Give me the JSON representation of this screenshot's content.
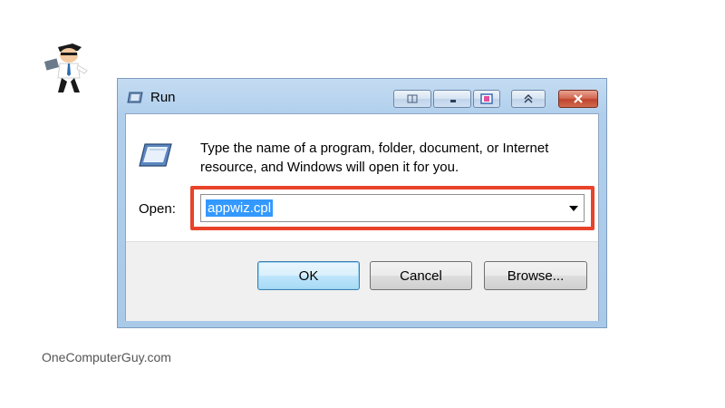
{
  "window": {
    "title": "Run",
    "description": "Type the name of a program, folder, document, or Internet resource, and Windows will open it for you.",
    "open_label": "Open:",
    "open_value": "appwiz.cpl"
  },
  "buttons": {
    "ok": "OK",
    "cancel": "Cancel",
    "browse": "Browse..."
  },
  "watermark": "OneComputerGuy.com",
  "colors": {
    "highlight_border": "#e8432a",
    "selection": "#3399ff",
    "close_button": "#c0452d"
  },
  "icons": {
    "title_icon": "run-icon",
    "minimize": "minimize-icon",
    "maximize": "maximize-icon",
    "close": "close-icon",
    "dropdown": "chevron-down-icon"
  }
}
